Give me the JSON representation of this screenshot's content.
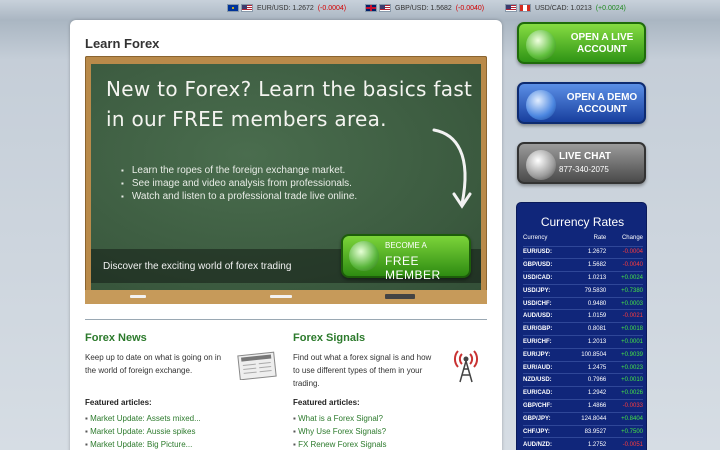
{
  "ticker": [
    {
      "pair": "EUR/USD:",
      "rate": "1.2672",
      "change": "(-0.0004)",
      "dir": "neg"
    },
    {
      "pair": "GBP/USD:",
      "rate": "1.5682",
      "change": "(-0.0040)",
      "dir": "neg"
    },
    {
      "pair": "USD/CAD:",
      "rate": "1.0213",
      "change": "(+0.0024)",
      "dir": "pos"
    }
  ],
  "panel": {
    "title": "Learn Forex",
    "board": {
      "headline": "New to Forex? Learn the basics fast in our FREE members area.",
      "bullets": [
        "Learn the ropes of the foreign exchange market.",
        "See image and video analysis from professionals.",
        "Watch and listen to a professional  trade live online."
      ],
      "strip_text": "Discover the exciting world of forex trading",
      "member_small": "BECOME A",
      "member_big": "FREE MEMBER"
    },
    "news": {
      "title": "Forex News",
      "text": "Keep up to date on what is going on in the world of foreign exchange.",
      "featured": "Featured articles:",
      "links": [
        "Market Update: Assets mixed...",
        "Market Update: Aussie spikes",
        "Market Update: Big Picture..."
      ]
    },
    "signals": {
      "title": "Forex Signals",
      "text": "Find out what a forex signal is and how to use different types of them in your trading.",
      "featured": "Featured articles:",
      "links": [
        "What is a Forex Signal?",
        "Why Use Forex Signals?",
        "FX Renew Forex Signals"
      ]
    }
  },
  "side": {
    "live_label": "OPEN A LIVE ACCOUNT",
    "demo_label": "OPEN A DEMO ACCOUNT",
    "chat_label": "LIVE CHAT",
    "chat_phone": "877-340-2075"
  },
  "rates": {
    "title": "Currency Rates",
    "headers": [
      "Currency",
      "Rate",
      "Change"
    ],
    "rows": [
      {
        "pair": "EUR/USD:",
        "rate": "1.2672",
        "change": "-0.0004",
        "dir": "neg"
      },
      {
        "pair": "GBP/USD:",
        "rate": "1.5682",
        "change": "-0.0040",
        "dir": "neg"
      },
      {
        "pair": "USD/CAD:",
        "rate": "1.0213",
        "change": "+0.0024",
        "dir": "pos"
      },
      {
        "pair": "USD/JPY:",
        "rate": "79.5830",
        "change": "+0.7380",
        "dir": "pos"
      },
      {
        "pair": "USD/CHF:",
        "rate": "0.9480",
        "change": "+0.0003",
        "dir": "pos"
      },
      {
        "pair": "AUD/USD:",
        "rate": "1.0159",
        "change": "-0.0021",
        "dir": "neg"
      },
      {
        "pair": "EUR/GBP:",
        "rate": "0.8081",
        "change": "+0.0018",
        "dir": "pos"
      },
      {
        "pair": "EUR/CHF:",
        "rate": "1.2013",
        "change": "+0.0001",
        "dir": "pos"
      },
      {
        "pair": "EUR/JPY:",
        "rate": "100.8504",
        "change": "+0.9039",
        "dir": "pos"
      },
      {
        "pair": "EUR/AUD:",
        "rate": "1.2475",
        "change": "+0.0023",
        "dir": "pos"
      },
      {
        "pair": "NZD/USD:",
        "rate": "0.7966",
        "change": "+0.0010",
        "dir": "pos"
      },
      {
        "pair": "EUR/CAD:",
        "rate": "1.2942",
        "change": "+0.0026",
        "dir": "pos"
      },
      {
        "pair": "GBP/CHF:",
        "rate": "1.4866",
        "change": "-0.0033",
        "dir": "neg"
      },
      {
        "pair": "GBP/JPY:",
        "rate": "124.8044",
        "change": "+0.8404",
        "dir": "pos"
      },
      {
        "pair": "CHF/JPY:",
        "rate": "83.9527",
        "change": "+0.7500",
        "dir": "pos"
      },
      {
        "pair": "AUD/NZD:",
        "rate": "1.2752",
        "change": "-0.0051",
        "dir": "neg"
      }
    ]
  }
}
